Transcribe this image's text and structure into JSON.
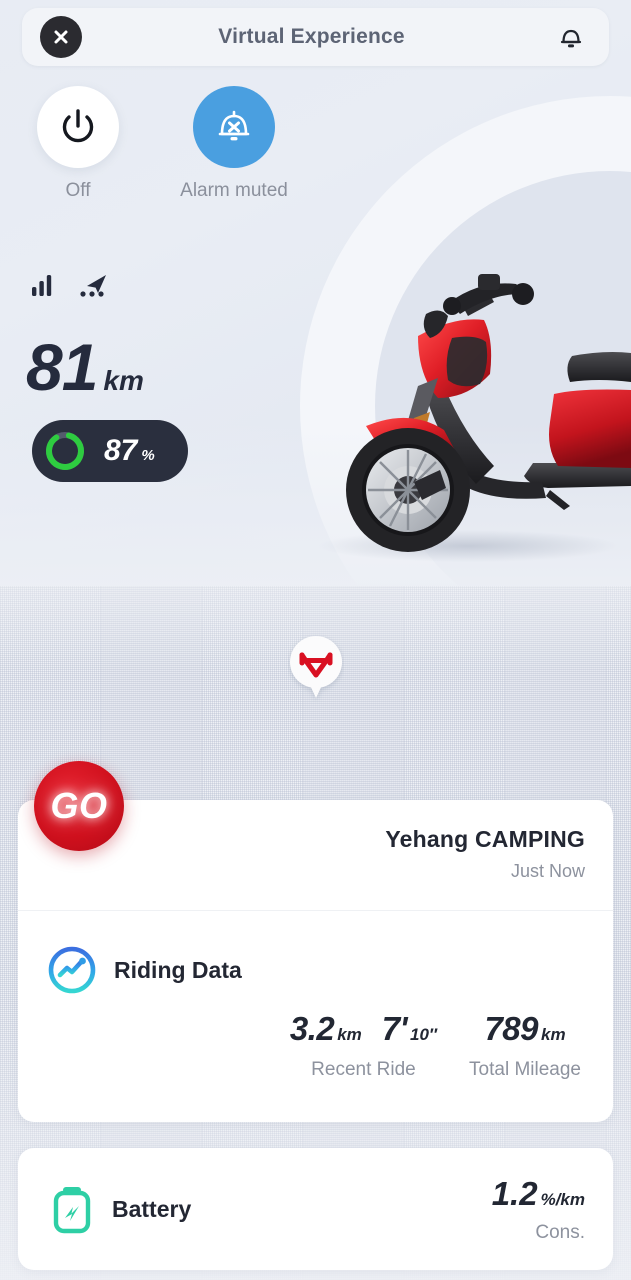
{
  "header": {
    "title": "Virtual Experience",
    "close_icon": "close-icon",
    "bell_icon": "bell-icon"
  },
  "quick_actions": [
    {
      "label": "Off",
      "icon": "power-icon",
      "state": "off"
    },
    {
      "label": "Alarm muted",
      "icon": "bell-muted-icon",
      "state": "active",
      "color": "#4a9fe0"
    }
  ],
  "status": {
    "signal_icon": "signal-bars-icon",
    "gps_icon": "navigation-arrow-icon",
    "range_value": "81",
    "range_unit": "km",
    "battery_percent": "87",
    "battery_percent_symbol": "%",
    "battery_level": 87,
    "battery_ring_color": "#2ecc40",
    "battery_pill_color": "#2a2f3e"
  },
  "vehicle": {
    "image": "red-electric-scooter",
    "name": "Yehang CAMPING",
    "last_update": "Just Now"
  },
  "map": {
    "pin_icon": "niu-bull-logo-pin",
    "pin_color": "#d91022"
  },
  "go_button": {
    "label": "GO",
    "color": "#d0101d"
  },
  "riding_data": {
    "icon": "riding-chart-icon",
    "title": "Riding Data",
    "recent_ride": {
      "label": "Recent Ride",
      "distance_value": "3.2",
      "distance_unit": "km",
      "duration_minutes": "7'",
      "duration_seconds": "10″"
    },
    "total_mileage": {
      "label": "Total Mileage",
      "value": "789",
      "unit": "km"
    }
  },
  "battery_card": {
    "icon": "battery-bolt-icon",
    "title": "Battery",
    "consumption_value": "1.2",
    "consumption_unit": "%/km",
    "consumption_label": "Cons.",
    "icon_color": "#2ecfa5"
  }
}
